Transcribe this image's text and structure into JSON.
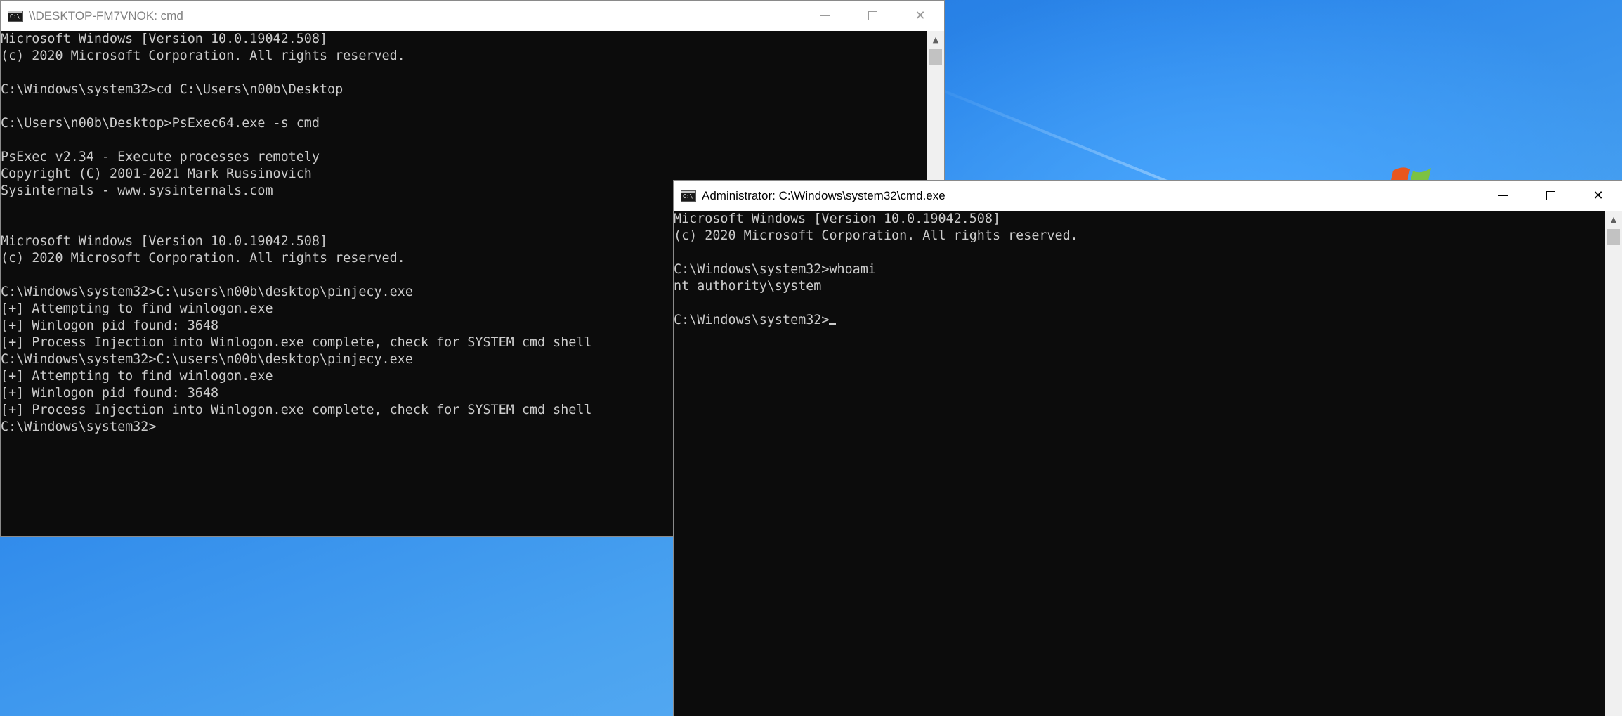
{
  "window1": {
    "title": "\\\\DESKTOP-FM7VNOK: cmd",
    "lines": [
      "Microsoft Windows [Version 10.0.19042.508]",
      "(c) 2020 Microsoft Corporation. All rights reserved.",
      "",
      "C:\\Windows\\system32>cd C:\\Users\\n00b\\Desktop",
      "",
      "C:\\Users\\n00b\\Desktop>PsExec64.exe -s cmd",
      "",
      "PsExec v2.34 - Execute processes remotely",
      "Copyright (C) 2001-2021 Mark Russinovich",
      "Sysinternals - www.sysinternals.com",
      "",
      "",
      "Microsoft Windows [Version 10.0.19042.508]",
      "(c) 2020 Microsoft Corporation. All rights reserved.",
      "",
      "C:\\Windows\\system32>C:\\users\\n00b\\desktop\\pinjecy.exe",
      "[+] Attempting to find winlogon.exe",
      "[+] Winlogon pid found: 3648",
      "[+] Process Injection into Winlogon.exe complete, check for SYSTEM cmd shell",
      "C:\\Windows\\system32>C:\\users\\n00b\\desktop\\pinjecy.exe",
      "[+] Attempting to find winlogon.exe",
      "[+] Winlogon pid found: 3648",
      "[+] Process Injection into Winlogon.exe complete, check for SYSTEM cmd shell",
      "C:\\Windows\\system32>"
    ]
  },
  "window2": {
    "title": "Administrator: C:\\Windows\\system32\\cmd.exe",
    "lines": [
      "Microsoft Windows [Version 10.0.19042.508]",
      "(c) 2020 Microsoft Corporation. All rights reserved.",
      "",
      "C:\\Windows\\system32>whoami",
      "nt authority\\system",
      "",
      "C:\\Windows\\system32>"
    ]
  },
  "icons": {
    "app": "cmd-app-icon",
    "minimize": "minimize-icon",
    "maximize": "maximize-icon",
    "close": "close-icon",
    "scroll_up": "scroll-up-icon",
    "scroll_down": "scroll-down-icon"
  },
  "colors": {
    "console_bg": "#0c0c0c",
    "console_fg": "#cccccc",
    "desktop_blue": "#2b86ea"
  }
}
